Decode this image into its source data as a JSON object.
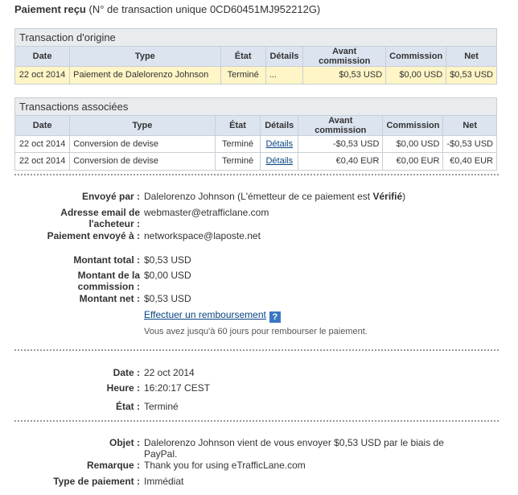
{
  "header": {
    "title": "Paiement reçu",
    "transaction_text": "(N° de transaction unique 0CD60451MJ952212G)"
  },
  "columns": [
    "Date",
    "Type",
    "État",
    "Détails",
    "Avant commission",
    "Commission",
    "Net"
  ],
  "origin": {
    "title": "Transaction d'origine",
    "row": {
      "date": "22 oct 2014",
      "type": "Paiement de Dalelorenzo Johnson",
      "state": "Terminé",
      "details": "...",
      "gross": "$0,53 USD",
      "fee": "$0,00 USD",
      "net": "$0,53 USD"
    }
  },
  "related": {
    "title": "Transactions associées",
    "rows": [
      {
        "date": "22 oct 2014",
        "type": "Conversion de devise",
        "state": "Terminé",
        "details": "Détails",
        "gross": "-$0,53 USD",
        "fee": "$0,00 USD",
        "net": "-$0,53 USD"
      },
      {
        "date": "22 oct 2014",
        "type": "Conversion de devise",
        "state": "Terminé",
        "details": "Détails",
        "gross": "€0,40 EUR",
        "fee": "€0,00 EUR",
        "net": "€0,40 EUR"
      }
    ]
  },
  "sender": {
    "sent_by_label": "Envoyé par :",
    "sent_by_value": "Dalelorenzo Johnson (L'émetteur de ce paiement est ",
    "verified": "Vérifié",
    "close_paren": ")",
    "email_label_1": "Adresse email de",
    "email_label_2": "l'acheteur :",
    "email_value": "webmaster@etrafficlane.com",
    "sent_to_label": "Paiement envoyé à :",
    "sent_to_value": "networkspace@laposte.net"
  },
  "amounts": {
    "total_label": "Montant total :",
    "total_value": "$0,53 USD",
    "fee_label_1": "Montant de la",
    "fee_label_2": "commission :",
    "fee_value": "$0,00 USD",
    "net_label": "Montant net :",
    "net_value": "$0,53 USD",
    "refund_link": "Effectuer un remboursement",
    "help": "?",
    "refund_note": "Vous avez jusqu'à 60 jours pour rembourser le paiement."
  },
  "timing": {
    "date_label": "Date :",
    "date_value": "22 oct 2014",
    "time_label": "Heure :",
    "time_value": "16:20:17 CEST",
    "state_label": "État :",
    "state_value": "Terminé"
  },
  "message": {
    "subject_label": "Objet :",
    "subject_line1": "Dalelorenzo Johnson vient de vous envoyer $0,53 USD par le biais de",
    "subject_line2": "PayPal.",
    "note_label": "Remarque :",
    "note_value": "Thank you for using eTrafficLane.com",
    "type_label": "Type de paiement :",
    "type_value": "Immédiat"
  },
  "colors": {
    "link": "#084482",
    "highlight_row": "#fff5c6",
    "table_header": "#dce4f0",
    "panel_header": "#e8ecef"
  }
}
